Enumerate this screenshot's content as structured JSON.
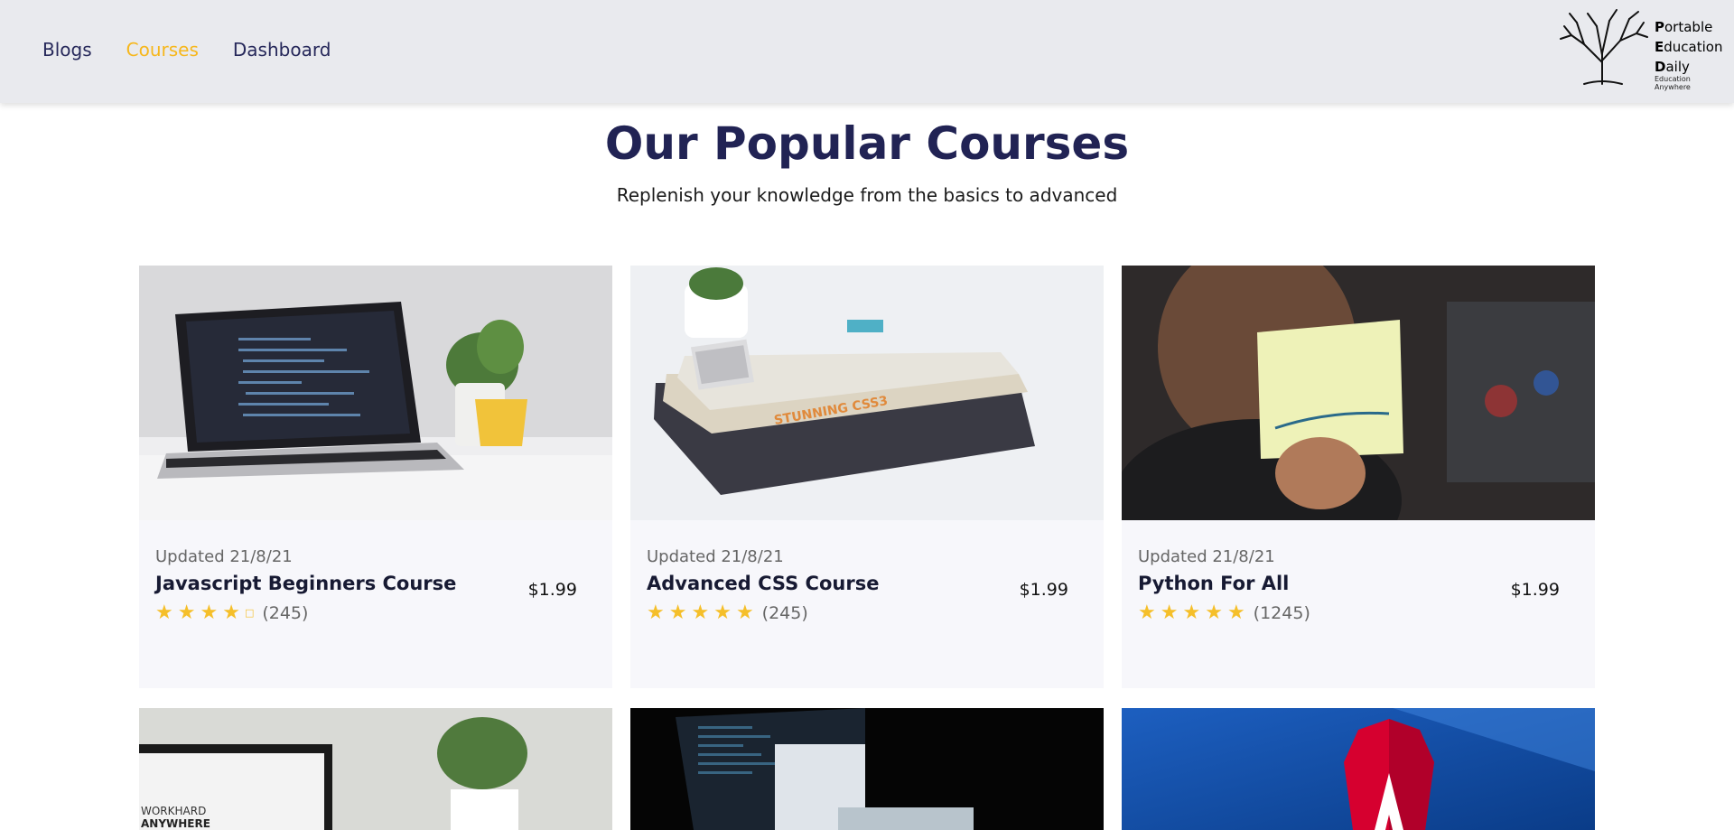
{
  "nav": {
    "items": [
      {
        "label": "Blogs",
        "active": false
      },
      {
        "label": "Courses",
        "active": true
      },
      {
        "label": "Dashboard",
        "active": false
      }
    ],
    "active_color": "#f6b71c"
  },
  "logo": {
    "line1_initial": "P",
    "line1_rest": "ortable",
    "line2_initial": "E",
    "line2_rest": "ducation",
    "line3_initial": "D",
    "line3_rest": "aily",
    "tagline": "Education Anywhere"
  },
  "hero": {
    "title": "Our Popular Courses",
    "subtitle": "Replenish your knowledge from the basics to advanced"
  },
  "courses": [
    {
      "updated": "Updated 21/8/21",
      "title": "Javascript Beginners Course",
      "price": "$1.99",
      "rating": 4,
      "count": "(245)",
      "image": "laptop-code"
    },
    {
      "updated": "Updated 21/8/21",
      "title": "Advanced CSS Course",
      "price": "$1.99",
      "rating": 5,
      "count": "(245)",
      "image": "css-books"
    },
    {
      "updated": "Updated 21/8/21",
      "title": "Python For All",
      "price": "$1.99",
      "rating": 5,
      "count": "(1245)",
      "image": "python-note"
    }
  ],
  "second_row_images": [
    "workhard-anywhere",
    "dark-laptops",
    "angular"
  ],
  "second_row_text": {
    "workhard_line1": "WORKHARD",
    "workhard_line2": "ANYWHERE"
  },
  "colors": {
    "title": "#212354",
    "star": "#f5bf2a",
    "header_bg": "#e9eaee"
  }
}
